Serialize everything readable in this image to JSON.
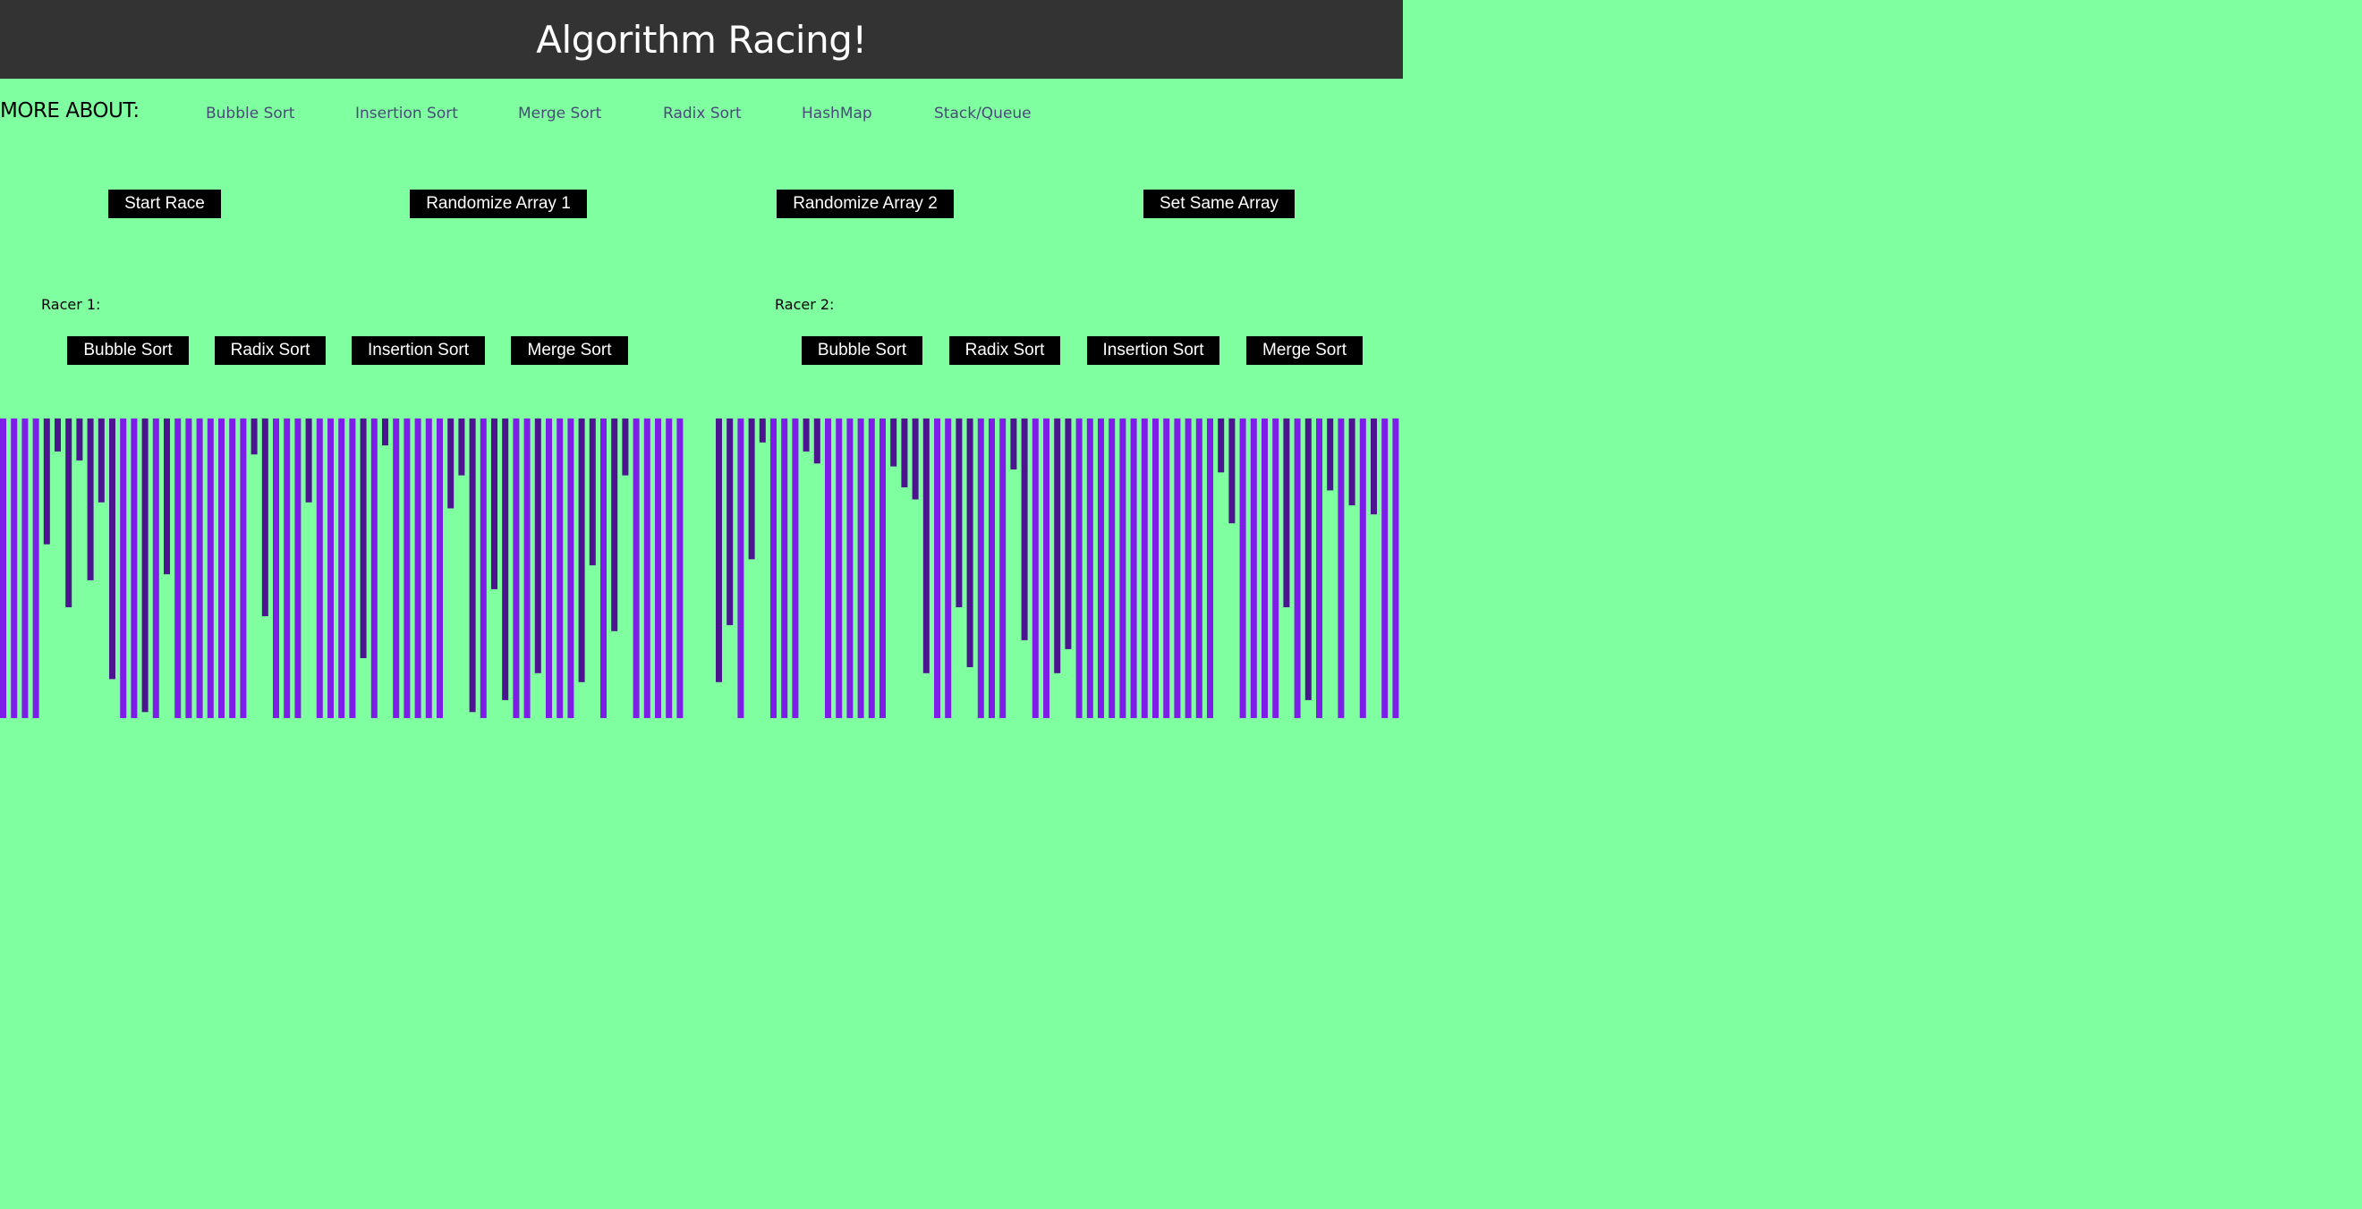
{
  "header": {
    "title": "Algorithm Racing!"
  },
  "nav": {
    "label": "MORE ABOUT:",
    "links": [
      "Bubble Sort",
      "Insertion Sort",
      "Merge Sort",
      "Radix Sort",
      "HashMap",
      "Stack/Queue"
    ]
  },
  "controls": {
    "start": "Start Race",
    "randomize1": "Randomize Array 1",
    "randomize2": "Randomize Array 2",
    "same": "Set Same Array"
  },
  "racer1": {
    "label": "Racer 1:",
    "buttons": [
      "Bubble Sort",
      "Radix Sort",
      "Insertion Sort",
      "Merge Sort"
    ]
  },
  "racer2": {
    "label": "Racer 2:",
    "buttons": [
      "Bubble Sort",
      "Radix Sort",
      "Insertion Sort",
      "Merge Sort"
    ]
  },
  "colors": {
    "background": "#80ffa0",
    "header": "#333333",
    "bar_light": "#7f1de8",
    "bar_dark": "#4c148e"
  },
  "arrays": {
    "array1": [
      {
        "v": 1,
        "c": "l"
      },
      {
        "v": 1,
        "c": "l"
      },
      {
        "v": 1,
        "c": "l"
      },
      {
        "v": 1,
        "c": "l"
      },
      {
        "v": 0.42,
        "c": "d"
      },
      {
        "v": 0.11,
        "c": "d"
      },
      {
        "v": 0.63,
        "c": "d"
      },
      {
        "v": 0.14,
        "c": "d"
      },
      {
        "v": 0.54,
        "c": "d"
      },
      {
        "v": 0.28,
        "c": "d"
      },
      {
        "v": 0.87,
        "c": "d"
      },
      {
        "v": 1,
        "c": "l"
      },
      {
        "v": 1,
        "c": "l"
      },
      {
        "v": 0.98,
        "c": "d"
      },
      {
        "v": 1,
        "c": "l"
      },
      {
        "v": 0.52,
        "c": "d"
      },
      {
        "v": 1,
        "c": "l"
      },
      {
        "v": 1,
        "c": "l"
      },
      {
        "v": 1,
        "c": "l"
      },
      {
        "v": 1,
        "c": "l"
      },
      {
        "v": 1,
        "c": "l"
      },
      {
        "v": 1,
        "c": "l"
      },
      {
        "v": 1,
        "c": "l"
      },
      {
        "v": 0.12,
        "c": "d"
      },
      {
        "v": 0.66,
        "c": "d"
      },
      {
        "v": 1,
        "c": "l"
      },
      {
        "v": 1,
        "c": "l"
      },
      {
        "v": 1,
        "c": "l"
      },
      {
        "v": 0.28,
        "c": "d"
      },
      {
        "v": 1,
        "c": "l"
      },
      {
        "v": 1,
        "c": "l"
      },
      {
        "v": 1,
        "c": "l"
      },
      {
        "v": 1,
        "c": "l"
      },
      {
        "v": 0.8,
        "c": "d"
      },
      {
        "v": 1,
        "c": "l"
      },
      {
        "v": 0.09,
        "c": "d"
      },
      {
        "v": 1,
        "c": "l"
      },
      {
        "v": 1,
        "c": "l"
      },
      {
        "v": 1,
        "c": "l"
      },
      {
        "v": 1,
        "c": "l"
      },
      {
        "v": 1,
        "c": "l"
      },
      {
        "v": 0.3,
        "c": "d"
      },
      {
        "v": 0.19,
        "c": "d"
      },
      {
        "v": 0.98,
        "c": "d"
      },
      {
        "v": 1,
        "c": "l"
      },
      {
        "v": 0.57,
        "c": "d"
      },
      {
        "v": 0.94,
        "c": "d"
      },
      {
        "v": 1,
        "c": "l"
      },
      {
        "v": 1,
        "c": "l"
      },
      {
        "v": 0.85,
        "c": "d"
      },
      {
        "v": 1,
        "c": "l"
      },
      {
        "v": 1,
        "c": "l"
      },
      {
        "v": 1,
        "c": "l"
      },
      {
        "v": 0.88,
        "c": "d"
      },
      {
        "v": 0.49,
        "c": "d"
      },
      {
        "v": 1,
        "c": "l"
      },
      {
        "v": 0.71,
        "c": "d"
      },
      {
        "v": 0.19,
        "c": "d"
      },
      {
        "v": 1,
        "c": "l"
      },
      {
        "v": 1,
        "c": "l"
      },
      {
        "v": 1,
        "c": "l"
      },
      {
        "v": 1,
        "c": "l"
      },
      {
        "v": 1,
        "c": "l"
      }
    ],
    "array2": [
      {
        "v": 0.88,
        "c": "d"
      },
      {
        "v": 0.69,
        "c": "d"
      },
      {
        "v": 1,
        "c": "l"
      },
      {
        "v": 0.47,
        "c": "d"
      },
      {
        "v": 0.08,
        "c": "d"
      },
      {
        "v": 1,
        "c": "l"
      },
      {
        "v": 1,
        "c": "l"
      },
      {
        "v": 1,
        "c": "l"
      },
      {
        "v": 0.11,
        "c": "d"
      },
      {
        "v": 0.15,
        "c": "d"
      },
      {
        "v": 1,
        "c": "l"
      },
      {
        "v": 1,
        "c": "l"
      },
      {
        "v": 1,
        "c": "l"
      },
      {
        "v": 1,
        "c": "l"
      },
      {
        "v": 1,
        "c": "l"
      },
      {
        "v": 1,
        "c": "l"
      },
      {
        "v": 0.16,
        "c": "d"
      },
      {
        "v": 0.23,
        "c": "d"
      },
      {
        "v": 0.27,
        "c": "d"
      },
      {
        "v": 0.85,
        "c": "d"
      },
      {
        "v": 1,
        "c": "l"
      },
      {
        "v": 1,
        "c": "l"
      },
      {
        "v": 0.63,
        "c": "d"
      },
      {
        "v": 0.83,
        "c": "d"
      },
      {
        "v": 1,
        "c": "l"
      },
      {
        "v": 1,
        "c": "l"
      },
      {
        "v": 1,
        "c": "l"
      },
      {
        "v": 0.17,
        "c": "d"
      },
      {
        "v": 0.74,
        "c": "d"
      },
      {
        "v": 1,
        "c": "l"
      },
      {
        "v": 1,
        "c": "l"
      },
      {
        "v": 0.85,
        "c": "d"
      },
      {
        "v": 0.77,
        "c": "d"
      },
      {
        "v": 1,
        "c": "l"
      },
      {
        "v": 1,
        "c": "l"
      },
      {
        "v": 1,
        "c": "l"
      },
      {
        "v": 1,
        "c": "l"
      },
      {
        "v": 1,
        "c": "l"
      },
      {
        "v": 1,
        "c": "l"
      },
      {
        "v": 1,
        "c": "l"
      },
      {
        "v": 1,
        "c": "l"
      },
      {
        "v": 1,
        "c": "l"
      },
      {
        "v": 1,
        "c": "l"
      },
      {
        "v": 1,
        "c": "l"
      },
      {
        "v": 1,
        "c": "l"
      },
      {
        "v": 1,
        "c": "l"
      },
      {
        "v": 0.18,
        "c": "d"
      },
      {
        "v": 0.35,
        "c": "d"
      },
      {
        "v": 1,
        "c": "l"
      },
      {
        "v": 1,
        "c": "l"
      },
      {
        "v": 1,
        "c": "l"
      },
      {
        "v": 1,
        "c": "l"
      },
      {
        "v": 0.63,
        "c": "d"
      },
      {
        "v": 1,
        "c": "l"
      },
      {
        "v": 0.94,
        "c": "d"
      },
      {
        "v": 1,
        "c": "l"
      },
      {
        "v": 0.24,
        "c": "d"
      },
      {
        "v": 1,
        "c": "l"
      },
      {
        "v": 0.29,
        "c": "d"
      },
      {
        "v": 1,
        "c": "l"
      },
      {
        "v": 0.32,
        "c": "d"
      },
      {
        "v": 1,
        "c": "l"
      },
      {
        "v": 1,
        "c": "l"
      },
      {
        "v": 0.8,
        "c": "d"
      }
    ]
  }
}
